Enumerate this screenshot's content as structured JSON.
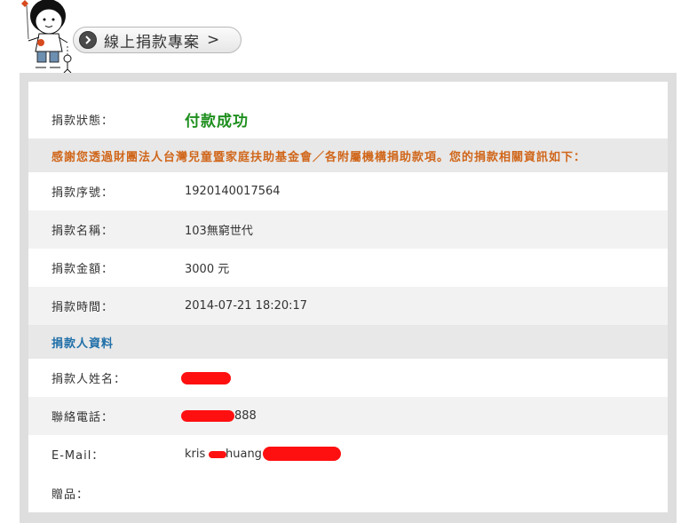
{
  "header": {
    "title": "線上捐款專案",
    "chevron": ">"
  },
  "status": {
    "label": "捐款狀態：",
    "value": "付款成功"
  },
  "thanks_message": "感謝您透過財團法人台灣兒童暨家庭扶助基金會／各附屬機構捐助款項。您的捐款相關資訊如下：",
  "donation": {
    "serial": {
      "label": "捐款序號：",
      "value": "1920140017564"
    },
    "name": {
      "label": "捐款名稱：",
      "value": "103無窮世代"
    },
    "amount": {
      "label": "捐款金額：",
      "value": "3000 元"
    },
    "time": {
      "label": "捐款時間：",
      "value": "2014-07-21 18:20:17"
    }
  },
  "donor": {
    "section_title": "捐款人資料",
    "name": {
      "label": "捐款人姓名：",
      "value": ""
    },
    "phone": {
      "label": "聯絡電話：",
      "value_visible": "888"
    },
    "email": {
      "label": "E-Mail：",
      "value_prefix": "kris",
      "value_middle": "huang"
    },
    "gift": {
      "label": "贈品：",
      "value": ""
    }
  },
  "colors": {
    "status_green": "#1f8f1f",
    "thanks_orange": "#d0661a",
    "section_blue": "#1f6fa8",
    "redaction_red": "#ff1010",
    "frame_gray": "#dedede"
  },
  "icons": [
    "mascot-illustration",
    "chevron-right-circle-icon"
  ]
}
